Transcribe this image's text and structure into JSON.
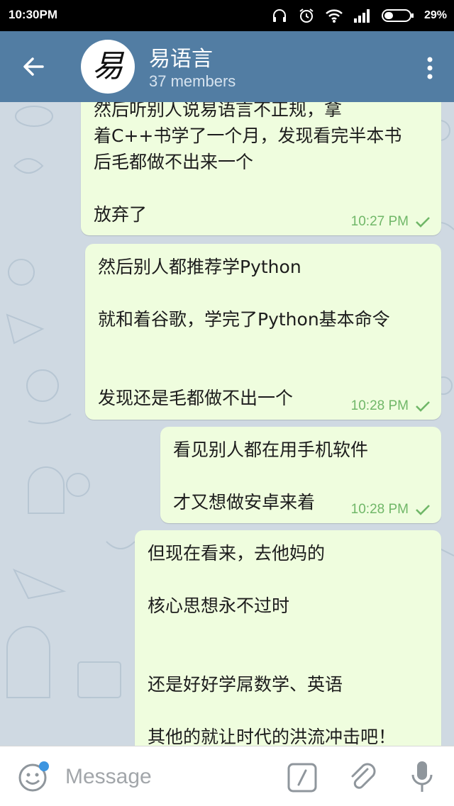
{
  "status_bar": {
    "time": "10:30PM",
    "battery": "29%",
    "icons": [
      "headset-icon",
      "alarm-icon",
      "wifi-icon",
      "signal-icon",
      "battery-icon"
    ]
  },
  "header": {
    "title": "易语言",
    "subtitle": "37 members",
    "avatar_glyph": "易",
    "back_icon": "arrow-left-icon",
    "menu_icon": "more-vertical-icon",
    "color": "#527da3"
  },
  "messages": [
    {
      "lines": [
        "然后听别人说易语言不正规，拿",
        "着C++书学了一个月，发现看完半本书",
        "后毛都做不出来一个",
        "",
        "放弃了"
      ],
      "time": "10:27 PM",
      "status": "check-icon"
    },
    {
      "lines": [
        "然后别人都推荐学Python",
        "",
        "就和着谷歌，学完了Python基本命令",
        "",
        "",
        "发现还是毛都做不出一个"
      ],
      "time": "10:28 PM",
      "status": "check-icon"
    },
    {
      "lines": [
        "看见别人都在用手机软件",
        "",
        "才又想做安卓来着"
      ],
      "time": "10:28 PM",
      "status": "check-icon"
    },
    {
      "lines": [
        "但现在看来，去他妈的",
        "",
        "核心思想永不过时",
        "",
        "",
        "还是好好学屌数学、英语",
        "",
        "其他的就让时代的洪流冲击吧！"
      ],
      "time": "",
      "status": ""
    }
  ],
  "composer": {
    "placeholder": "Message",
    "emoji_icon": "smiley-icon",
    "command_icon": "slash-command-icon",
    "attach_icon": "paperclip-icon",
    "mic_icon": "microphone-icon"
  },
  "colors": {
    "bubble": "#effdde",
    "time": "#70b768",
    "background": "#cfd9e2"
  }
}
